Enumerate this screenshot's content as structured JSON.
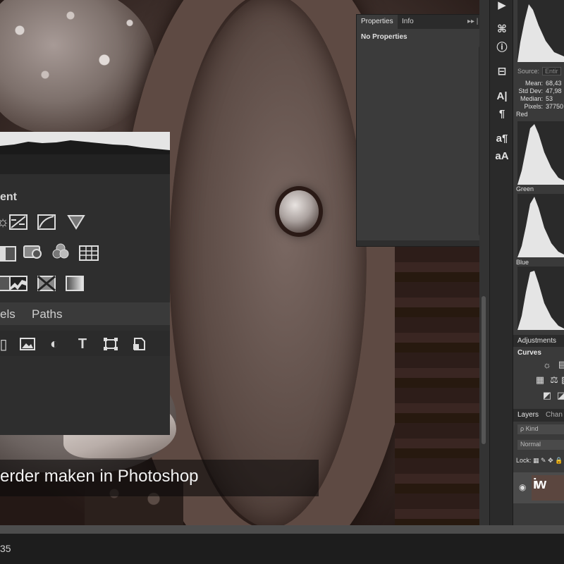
{
  "caption": {
    "text": "erder maken in Photoshop"
  },
  "adjustments_panel": {
    "title_fragment": "ent",
    "icons_row1": [
      "brightness-contrast-icon",
      "levels-icon",
      "curves-icon",
      "exposure-icon"
    ],
    "icons_row2": [
      "color-balance-icon",
      "photo-filter-icon",
      "channel-mixer-icon",
      "color-lookup-icon"
    ],
    "icons_row3": [
      "posterize-icon",
      "threshold-icon",
      "selective-color-icon",
      "gradient-map-icon"
    ]
  },
  "left_tabs": {
    "tab1": "els",
    "tab2": "Paths"
  },
  "properties_panel": {
    "tabs": [
      "Properties",
      "Info"
    ],
    "menu": "▸▸ | ≡",
    "message": "No Properties"
  },
  "histogram_panel": {
    "source_label": "Source:",
    "source_value": "Entir",
    "stats": [
      {
        "label": "Mean:",
        "value": "68,43"
      },
      {
        "label": "Std Dev:",
        "value": "47,98"
      },
      {
        "label": "Median:",
        "value": "53"
      },
      {
        "label": "Pixels:",
        "value": "37750"
      }
    ],
    "channels": [
      "Red",
      "Green",
      "Blue"
    ]
  },
  "adjustments_mini": {
    "tab": "Adjustments",
    "subtitle": "Curves"
  },
  "layers_panel": {
    "tabs": [
      "Layers",
      "Chan"
    ],
    "kind_filter": "ρ Kind",
    "blend_mode": "Normal",
    "lock_label": "Lock:",
    "thumb_text": "iw"
  },
  "status": {
    "time_code": "35"
  },
  "colors": {
    "panel": "#2e2e2e",
    "panel_light": "#3a3a3a",
    "caption_bg": "#0c0a0a"
  }
}
